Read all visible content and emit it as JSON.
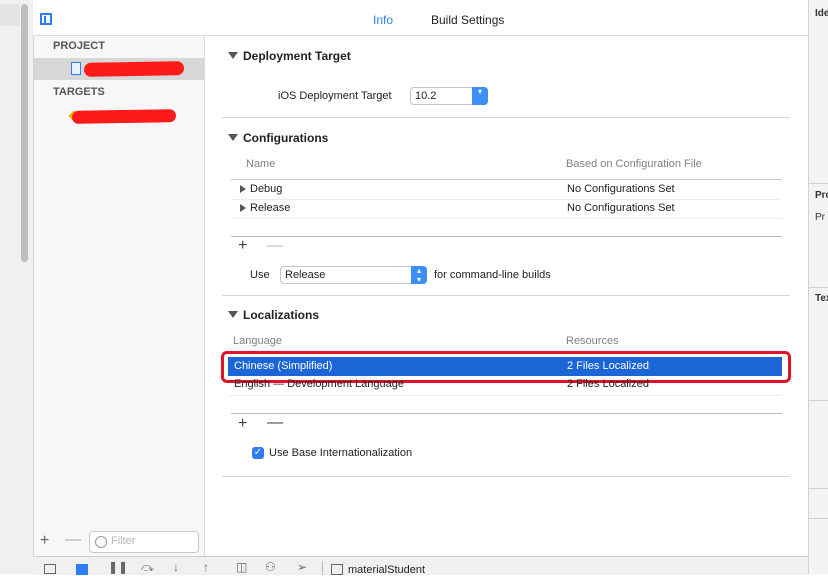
{
  "tabs": {
    "info": "Info",
    "build_settings": "Build Settings"
  },
  "sidebar": {
    "project_header": "PROJECT",
    "targets_header": "TARGETS",
    "filter_placeholder": "Filter",
    "add_symbol": "+",
    "remove_symbol": "—"
  },
  "deployment": {
    "title": "Deployment Target",
    "label": "iOS Deployment Target",
    "value": "10.2"
  },
  "configurations": {
    "title": "Configurations",
    "col_name": "Name",
    "col_based": "Based on Configuration File",
    "rows": [
      {
        "name": "Debug",
        "based": "No Configurations Set"
      },
      {
        "name": "Release",
        "based": "No Configurations Set"
      }
    ],
    "use_label": "Use",
    "use_value": "Release",
    "use_suffix": "for command-line builds"
  },
  "localizations": {
    "title": "Localizations",
    "col_language": "Language",
    "col_resources": "Resources",
    "rows": [
      {
        "language": "Chinese (Simplified)",
        "resources": "2 Files Localized"
      },
      {
        "language": "English — Development Language",
        "resources": "2 Files Localized"
      }
    ],
    "use_base": "Use Base Internationalization"
  },
  "inspector": {
    "identity": "Ide",
    "project": "Pro",
    "project_sub": "Pr",
    "text": "Tex"
  },
  "bottom": {
    "scheme": "materialStudent"
  },
  "colors": {
    "accent": "#2f7cf6",
    "selection": "#1c65d6",
    "annotation_red": "#e0112a"
  }
}
